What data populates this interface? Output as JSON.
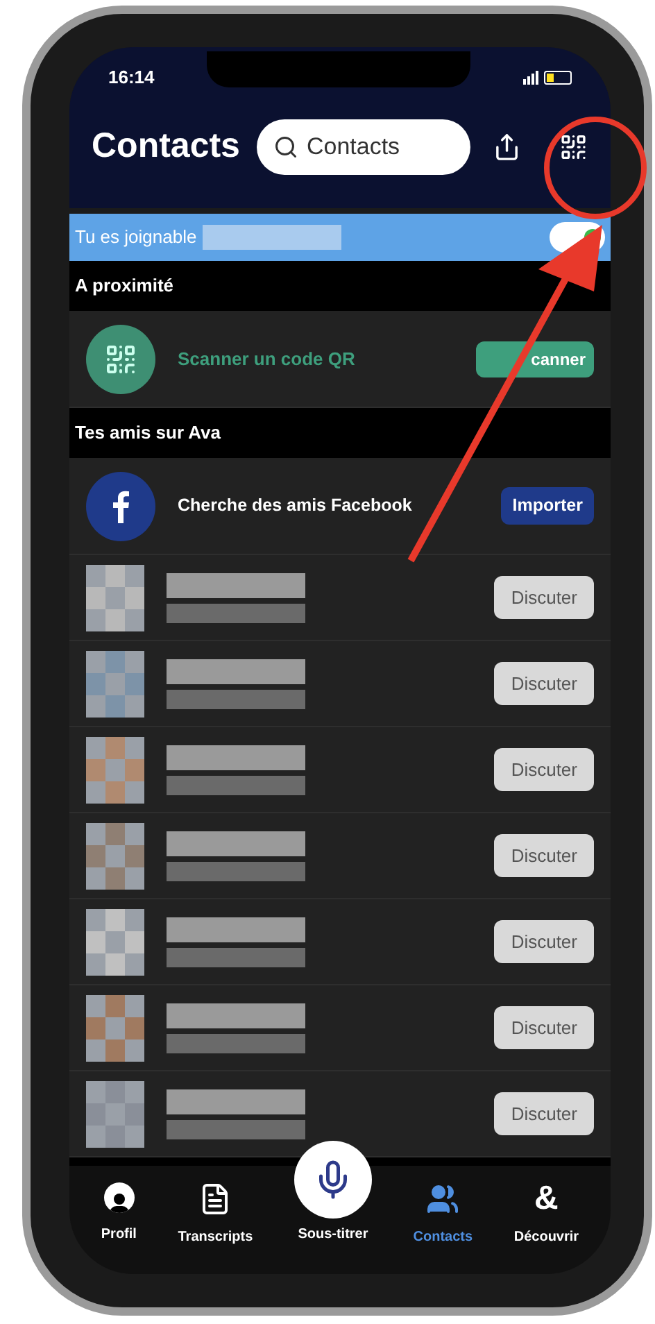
{
  "status_bar": {
    "time": "16:14"
  },
  "header": {
    "title": "Contacts",
    "search": {
      "placeholder": "Contacts"
    }
  },
  "banner": {
    "text": "Tu es joignable",
    "toggle_on": true
  },
  "sections": [
    {
      "title": "A proximité",
      "rows": [
        {
          "kind": "qr",
          "label": "Scanner un code QR",
          "button": "canner"
        }
      ]
    },
    {
      "title": "Tes amis sur Ava",
      "rows": [
        {
          "kind": "facebook",
          "label": "Cherche des amis Facebook",
          "button": "Importer"
        },
        {
          "kind": "contact",
          "button": "Discuter"
        },
        {
          "kind": "contact",
          "button": "Discuter"
        },
        {
          "kind": "contact",
          "button": "Discuter"
        },
        {
          "kind": "contact",
          "button": "Discuter"
        },
        {
          "kind": "contact",
          "button": "Discuter"
        },
        {
          "kind": "contact",
          "button": "Discuter"
        },
        {
          "kind": "contact",
          "button": "Discuter"
        }
      ]
    }
  ],
  "tab_bar": [
    {
      "kind": "profile",
      "label": "Profil",
      "selected": false
    },
    {
      "kind": "transcripts",
      "label": "Transcripts",
      "selected": false
    },
    {
      "kind": "mic",
      "label": "Sous-titrer",
      "selected": false
    },
    {
      "kind": "contacts",
      "label": "Contacts",
      "selected": true
    },
    {
      "kind": "discover",
      "label": "Découvrir",
      "icon_text": "&",
      "selected": false
    }
  ]
}
